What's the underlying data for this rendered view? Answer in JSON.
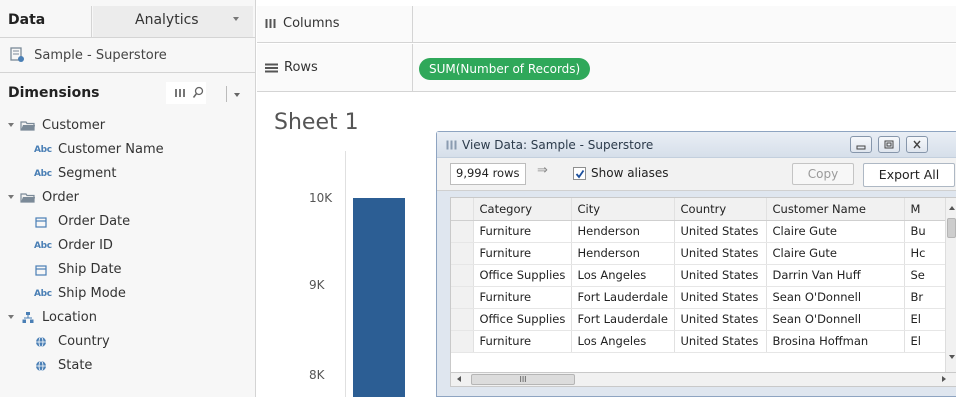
{
  "colors": {
    "pill": "#2fa85a",
    "bar": "#2c5e94",
    "field_icon": "#4a7fb5",
    "folder_icon": "#7b8a98"
  },
  "data_pane": {
    "tabs": [
      "Data",
      "Analytics"
    ],
    "datasource": "Sample - Superstore",
    "dimensions_title": "Dimensions",
    "tree": [
      {
        "label": "Customer",
        "type": "folder",
        "expanded": true
      },
      {
        "label": "Customer Name",
        "type": "string",
        "icon_text": "Abc"
      },
      {
        "label": "Segment",
        "type": "string",
        "icon_text": "Abc"
      },
      {
        "label": "Order",
        "type": "folder",
        "expanded": true
      },
      {
        "label": "Order Date",
        "type": "date"
      },
      {
        "label": "Order ID",
        "type": "string",
        "icon_text": "Abc"
      },
      {
        "label": "Ship Date",
        "type": "date"
      },
      {
        "label": "Ship Mode",
        "type": "string",
        "icon_text": "Abc"
      },
      {
        "label": "Location",
        "type": "hierarchy",
        "expanded": true
      },
      {
        "label": "Country",
        "type": "geo"
      },
      {
        "label": "State",
        "type": "geo"
      }
    ]
  },
  "shelves": {
    "columns_label": "Columns",
    "rows_label": "Rows",
    "rows_pill": "SUM(Number of Records)"
  },
  "sheet": {
    "title": "Sheet 1",
    "y_ticks": [
      "10K",
      "9K",
      "8K"
    ]
  },
  "chart_data": {
    "type": "bar",
    "series": [
      {
        "values": [
          9994
        ]
      }
    ],
    "ylabel": "",
    "y_ticks": [
      10000,
      9000,
      8000
    ]
  },
  "view_data": {
    "title": "View Data:  Sample - Superstore",
    "rows_count": "9,994 rows",
    "show_aliases_label": "Show aliases",
    "show_aliases_checked": true,
    "copy_label": "Copy",
    "export_label": "Export All",
    "hscroll_glyph": "III",
    "columns": [
      "Category",
      "City",
      "Country",
      "Customer Name",
      "M"
    ],
    "rows": [
      [
        "Furniture",
        "Henderson",
        "United States",
        "Claire Gute",
        "Bu"
      ],
      [
        "Furniture",
        "Henderson",
        "United States",
        "Claire Gute",
        "Hc"
      ],
      [
        "Office Supplies",
        "Los Angeles",
        "United States",
        "Darrin Van Huff",
        "Se"
      ],
      [
        "Furniture",
        "Fort Lauderdale",
        "United States",
        "Sean O'Donnell",
        "Br"
      ],
      [
        "Office Supplies",
        "Fort Lauderdale",
        "United States",
        "Sean O'Donnell",
        "El"
      ],
      [
        "Furniture",
        "Los Angeles",
        "United States",
        "Brosina Hoffman",
        "El"
      ]
    ]
  }
}
